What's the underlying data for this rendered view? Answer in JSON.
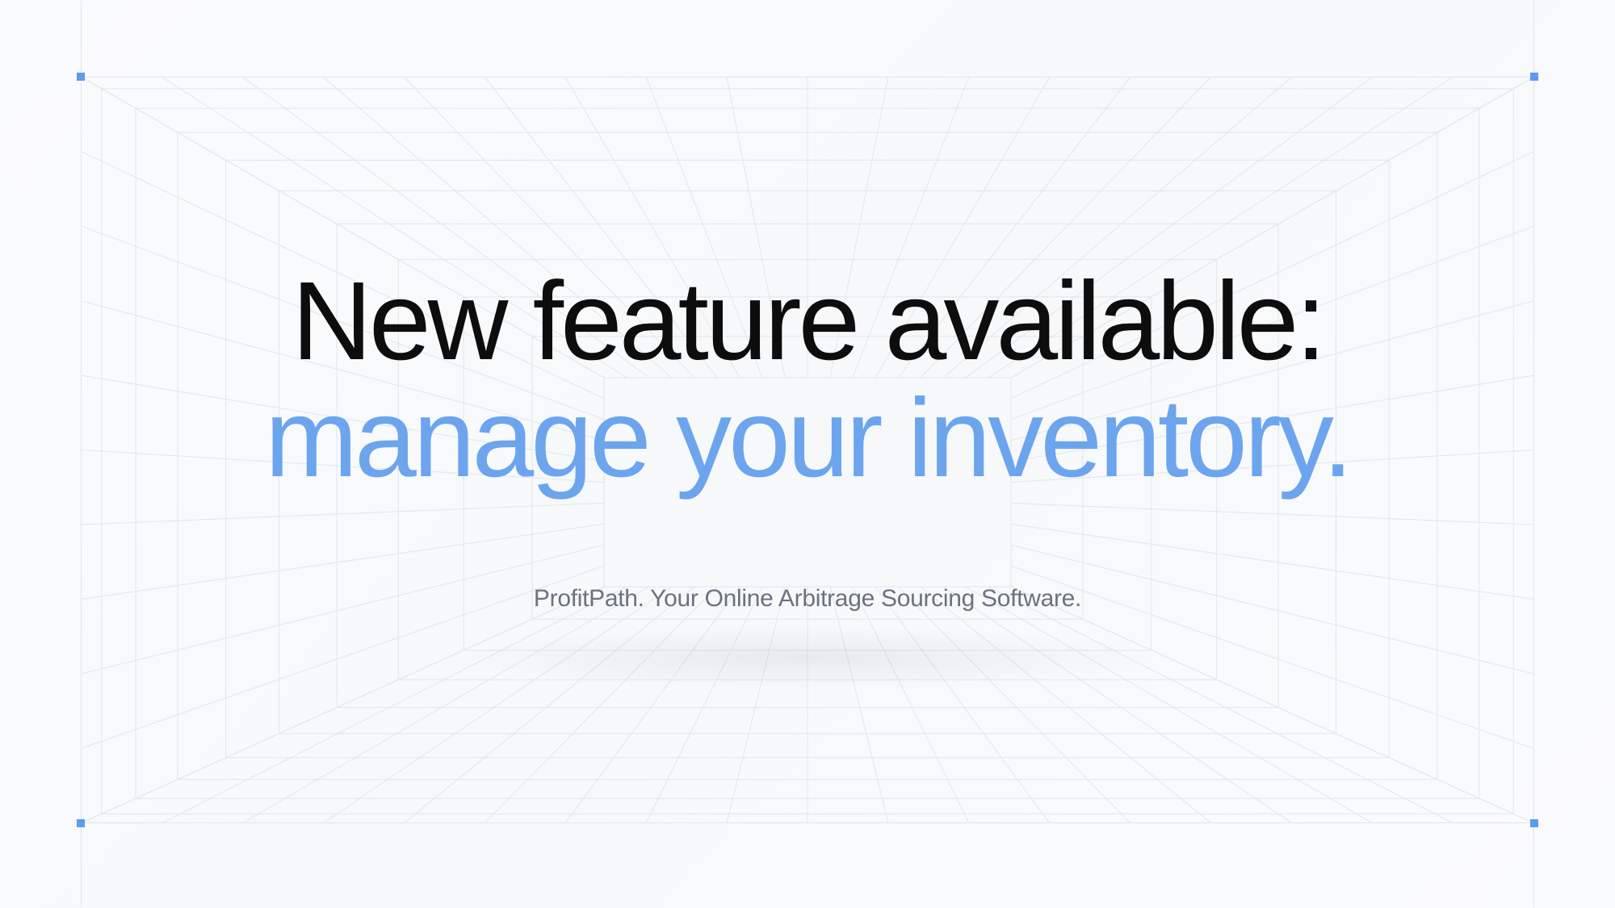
{
  "headline": {
    "part1": "New feature available: ",
    "part2": "manage your inventory."
  },
  "subtitle": "ProfitPath. Your Online Arbitrage Sourcing Software.",
  "colors": {
    "accent": "#6ca5ed",
    "corner": "#5b9bf0",
    "text": "#0d0d0d",
    "subtitle": "#6b7280",
    "grid": "#e2e6ea"
  }
}
